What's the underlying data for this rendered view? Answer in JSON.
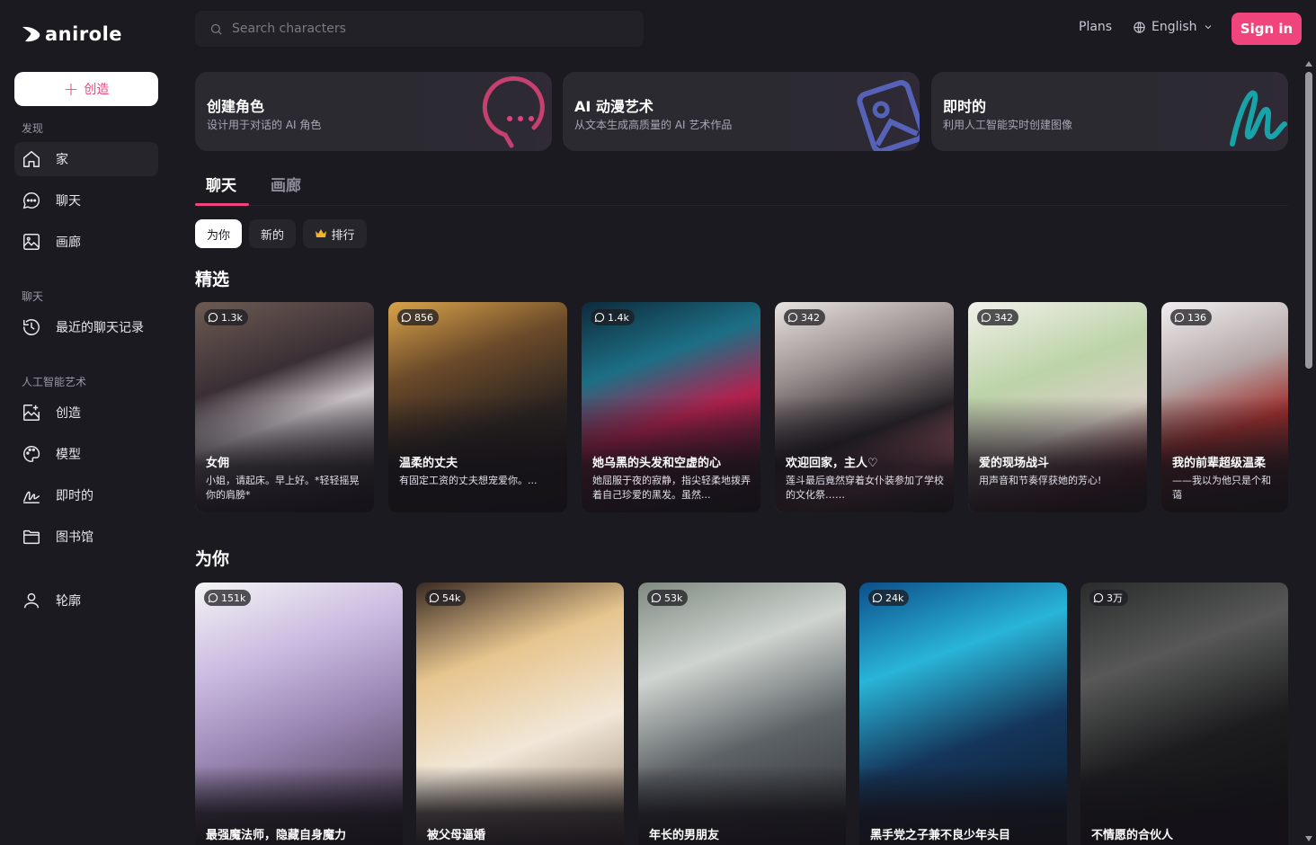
{
  "brand": {
    "logo_text": "anirole"
  },
  "sidebar": {
    "create_label": "创造",
    "sections": {
      "discover": "发现",
      "chat": "聊天",
      "ai_art": "人工智能艺术"
    },
    "items": [
      {
        "label": "家",
        "icon": "home-icon"
      },
      {
        "label": "聊天",
        "icon": "chat-bubble-icon"
      },
      {
        "label": "画廊",
        "icon": "image-icon"
      },
      {
        "label": "最近的聊天记录",
        "icon": "history-icon"
      },
      {
        "label": "创造",
        "icon": "image-edit-icon"
      },
      {
        "label": "模型",
        "icon": "palette-icon"
      },
      {
        "label": "即时的",
        "icon": "signature-icon"
      },
      {
        "label": "图书馆",
        "icon": "folder-icon"
      },
      {
        "label": "轮廓",
        "icon": "user-icon"
      }
    ]
  },
  "header": {
    "search_placeholder": "Search characters",
    "plans": "Plans",
    "language": "English",
    "sign_in": "Sign in"
  },
  "features": [
    {
      "title": "创建角色",
      "subtitle": "设计用于对话的 AI 角色",
      "icon": "chat-dots-icon"
    },
    {
      "title": "AI 动漫艺术",
      "subtitle": "从文本生成高质量的 AI 艺术作品",
      "icon": "photo-icon"
    },
    {
      "title": "即时的",
      "subtitle": "利用人工智能实时创建图像",
      "icon": "squiggle-icon"
    }
  ],
  "tabs": [
    "聊天",
    "画廊"
  ],
  "filters": [
    "为你",
    "新的",
    "排行"
  ],
  "featured": {
    "heading": "精选",
    "cards": [
      {
        "count": "1.3k",
        "name": "女佣",
        "desc": "小姐，请起床。早上好。*轻轻摇晃你的肩膀*"
      },
      {
        "count": "856",
        "name": "温柔的丈夫",
        "desc": "有固定工资的丈夫想宠爱你。..."
      },
      {
        "count": "1.4k",
        "name": "她乌黑的头发和空虚的心",
        "desc": "她屈服于夜的寂静，指尖轻柔地拨弄着自己珍爱的黑发。虽然..."
      },
      {
        "count": "342",
        "name": "欢迎回家，主人♡",
        "desc": "莲斗最后竟然穿着女仆装参加了学校的文化祭……"
      },
      {
        "count": "342",
        "name": "爱的现场战斗",
        "desc": "用声音和节奏俘获她的芳心!"
      },
      {
        "count": "136",
        "name": "我的前辈超级温柔",
        "desc": "——我以为他只是个和蔼"
      }
    ]
  },
  "for_you": {
    "heading": "为你",
    "cards": [
      {
        "count": "151k",
        "name": "最强魔法师，隐藏自身魔力"
      },
      {
        "count": "54k",
        "name": "被父母逼婚"
      },
      {
        "count": "53k",
        "name": "年长的男朋友"
      },
      {
        "count": "24k",
        "name": "黑手党之子兼不良少年头目"
      },
      {
        "count": "3万",
        "name": "不情愿的合伙人"
      }
    ]
  },
  "colors": {
    "accent": "#f0447c",
    "bg": "#1b1a20",
    "panel": "#26252c"
  }
}
